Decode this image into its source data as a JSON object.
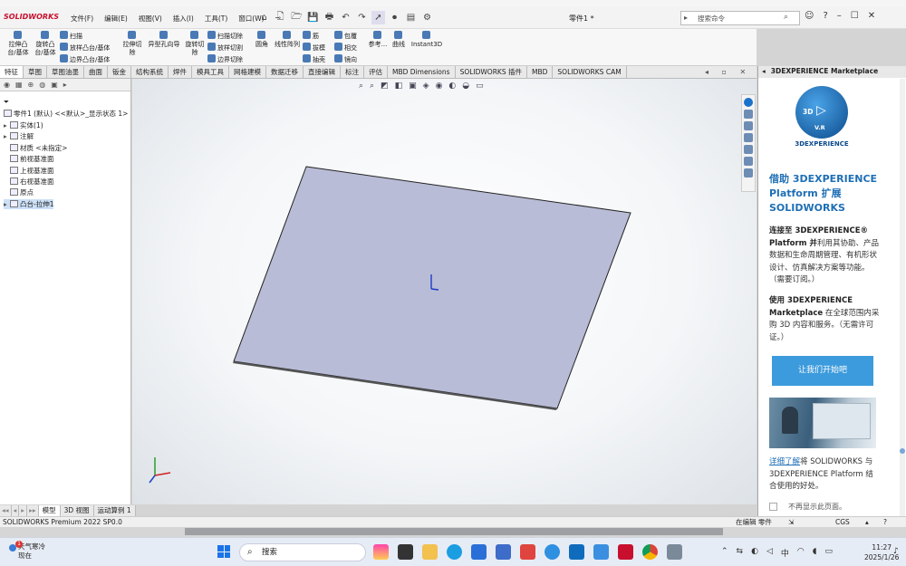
{
  "app": {
    "logo": "SOLIDWORKS",
    "doc_title": "零件1 *"
  },
  "menus": [
    "文件(F)",
    "编辑(E)",
    "视图(V)",
    "插入(I)",
    "工具(T)",
    "窗口(W)"
  ],
  "search": {
    "placeholder": "搜索命令"
  },
  "cmd": {
    "extrude_boss": "拉伸凸\n台/基体",
    "revolve_boss": "旋转凸\n台/基体",
    "sweep": "扫描",
    "loft": "放样凸台/基体",
    "boundary": "边界凸台/基体",
    "extrude_cut": "拉伸切\n除",
    "hole_wizard": "异型孔向导",
    "revolve_cut": "旋转切\n除",
    "swept_cut": "扫描切除",
    "lofted_cut": "放样切割",
    "boundary_cut": "边界切除",
    "fillet": "圆角",
    "linear_pattern": "线性阵列",
    "rib": "筋",
    "draft": "拔模",
    "shell": "抽壳",
    "wrap": "包覆",
    "intersect": "相交",
    "mirror": "镜向",
    "reference": "参考...",
    "curves": "曲线",
    "instant3d": "Instant3D"
  },
  "tabs": [
    "特征",
    "草图",
    "草图油墨",
    "曲面",
    "钣金",
    "结构系统",
    "焊件",
    "模具工具",
    "网格建模",
    "数据迁移",
    "直接编辑",
    "标注",
    "评估",
    "MBD Dimensions",
    "SOLIDWORKS 插件",
    "MBD",
    "SOLIDWORKS CAM"
  ],
  "tree": {
    "root": "零件1 (默认) <<默认>_显示状态 1>",
    "items": [
      {
        "label": "实体(1)",
        "expand": "▸"
      },
      {
        "label": "注解",
        "expand": "▸"
      },
      {
        "label": "材质 <未指定>",
        "expand": ""
      },
      {
        "label": "前视基准面",
        "expand": ""
      },
      {
        "label": "上视基准面",
        "expand": ""
      },
      {
        "label": "右视基准面",
        "expand": ""
      },
      {
        "label": "原点",
        "expand": ""
      },
      {
        "label": "凸台-拉伸1",
        "expand": "▸"
      }
    ]
  },
  "bottom_tabs": [
    "模型",
    "3D 视图",
    "运动算例 1"
  ],
  "marketplace": {
    "header": "3DEXPERIENCE Marketplace",
    "logo_text": "3DEXPERIENCE",
    "logo_version": "V.R",
    "logo_3d": "3D",
    "heading": "借助 3DEXPERIENCE Platform 扩展 SOLIDWORKS",
    "p1_bold1": "连接至 3DEXPERIENCE® Platform 并",
    "p1_rest": "利用其协助、产品数据和生命周期管理、有机形状设计、仿真解决方案等功能。（需要订阅。）",
    "p2_bold": "使用 3DEXPERIENCE Marketplace",
    "p2_rest": " 在全球范围内采购 3D 内容和服务。（无需许可证。）",
    "button": "让我们开始吧",
    "link": "详细了解",
    "link_rest": "将 SOLIDWORKS 与 3DEXPERIENCE Platform 结合使用的好处。",
    "checkbox_label": "不再显示此页面。"
  },
  "status": {
    "left": "SOLIDWORKS Premium 2022 SP0.0",
    "mode": "在编辑 零件",
    "units": "CGS"
  },
  "taskbar": {
    "weather": "天气寒冷",
    "weather_sub": "现在",
    "badge": "1",
    "search": "搜索",
    "tray_lang": "中",
    "time": "11:27",
    "date": "2025/1/26"
  },
  "colors": {
    "accent": "#3c9bdc",
    "plate": "#b9bcd6",
    "brand": "#c8102e"
  }
}
